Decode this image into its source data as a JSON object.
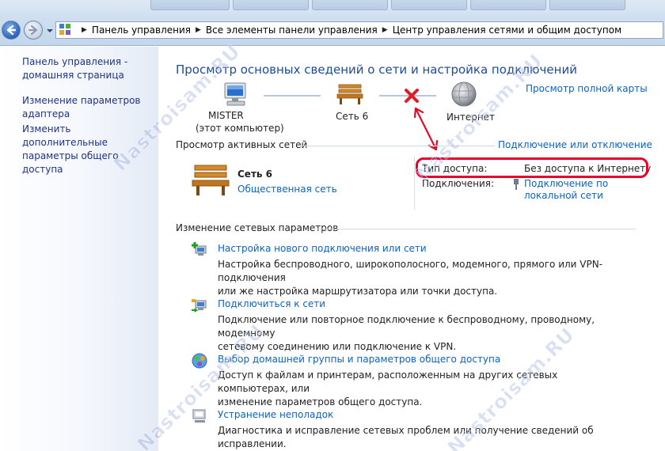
{
  "colors": {
    "link": "#0b63c0",
    "title": "#1e4b96",
    "highlight": "#e8002a",
    "sidebar_link": "#1e3287"
  },
  "address_bar": {
    "breadcrumbs": [
      "Панель управления",
      "Все элементы панели управления",
      "Центр управления сетями и общим доступом"
    ]
  },
  "sidebar": {
    "items": [
      {
        "line1": "Панель управления -",
        "line2": "домашняя страница"
      },
      {
        "line1": "Изменение параметров",
        "line2": "адаптера"
      },
      {
        "line1": "Изменить дополнительные",
        "line2": "параметры общего доступа"
      }
    ]
  },
  "main": {
    "title": "Просмотр основных сведений о сети и настройка подключений",
    "view_full_map": "Просмотр полной карты",
    "map": {
      "computer_name": "MISTER",
      "computer_sub": "(этот компьютер)",
      "network_name": "Сеть  6",
      "internet_label": "Интернет"
    },
    "active_networks": {
      "title": "Просмотр активных сетей",
      "connect_disconnect": "Подключение или отключение",
      "network_name": "Сеть  6",
      "network_type": "Общественная сеть",
      "access_type_label": "Тип доступа:",
      "access_type_value": "Без доступа к Интернету",
      "connections_label": "Подключения:",
      "connection_line1": "Подключение по",
      "connection_line2": "локальной сети"
    },
    "change_settings": {
      "title": "Изменение сетевых параметров",
      "tasks": [
        {
          "title": "Настройка нового подключения или сети",
          "desc1": "Настройка беспроводного, широкополосного, модемного, прямого или VPN-подключения",
          "desc2": "или же настройка маршрутизатора или точки доступа."
        },
        {
          "title": "Подключиться к сети",
          "desc1": "Подключение или повторное подключение к беспроводному, проводному, модемному",
          "desc2": "сетевому соединению или подключение к VPN."
        },
        {
          "title": "Выбор домашней группы и параметров общего доступа",
          "desc1": "Доступ к файлам и принтерам, расположенным на других сетевых компьютерах, или",
          "desc2": "изменение параметров общего доступа."
        },
        {
          "title": "Устранение неполадок",
          "desc1": "Диагностика и исправление сетевых проблем или получение сведений об исправлении.",
          "desc2": ""
        }
      ]
    }
  },
  "watermark": "Nastroisam.RU"
}
